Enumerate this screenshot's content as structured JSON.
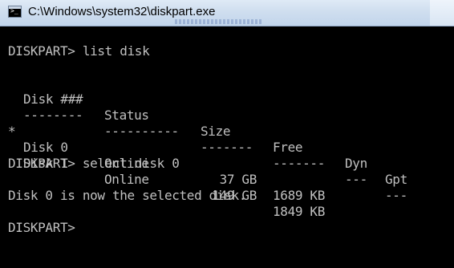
{
  "window": {
    "title": "C:\\Windows\\system32\\diskpart.exe",
    "icon": "cmd-console-icon",
    "icon_glyph": ">_"
  },
  "console": {
    "prompt1": "DISKPART> list disk",
    "headers": {
      "disk": "Disk ###",
      "status": "Status",
      "size": "Size",
      "free": "Free",
      "dyn": "Dyn",
      "gpt": "Gpt"
    },
    "separators": {
      "disk": "--------",
      "status": "----------",
      "size": "-------",
      "free": "-------",
      "dyn": "---",
      "gpt": "---"
    },
    "rows": [
      {
        "marker": "*",
        "disk": "Disk 0",
        "status": "Online",
        "size": "37 GB",
        "free": "1689 KB",
        "dyn": "",
        "gpt": ""
      },
      {
        "marker": "",
        "disk": "Disk 1",
        "status": "Online",
        "size": "149 GB",
        "free": "1849 KB",
        "dyn": "",
        "gpt": ""
      }
    ],
    "prompt2": "DISKPART> select disk 0",
    "message": "Disk 0 is now the selected disk.",
    "prompt3": "DISKPART>"
  }
}
